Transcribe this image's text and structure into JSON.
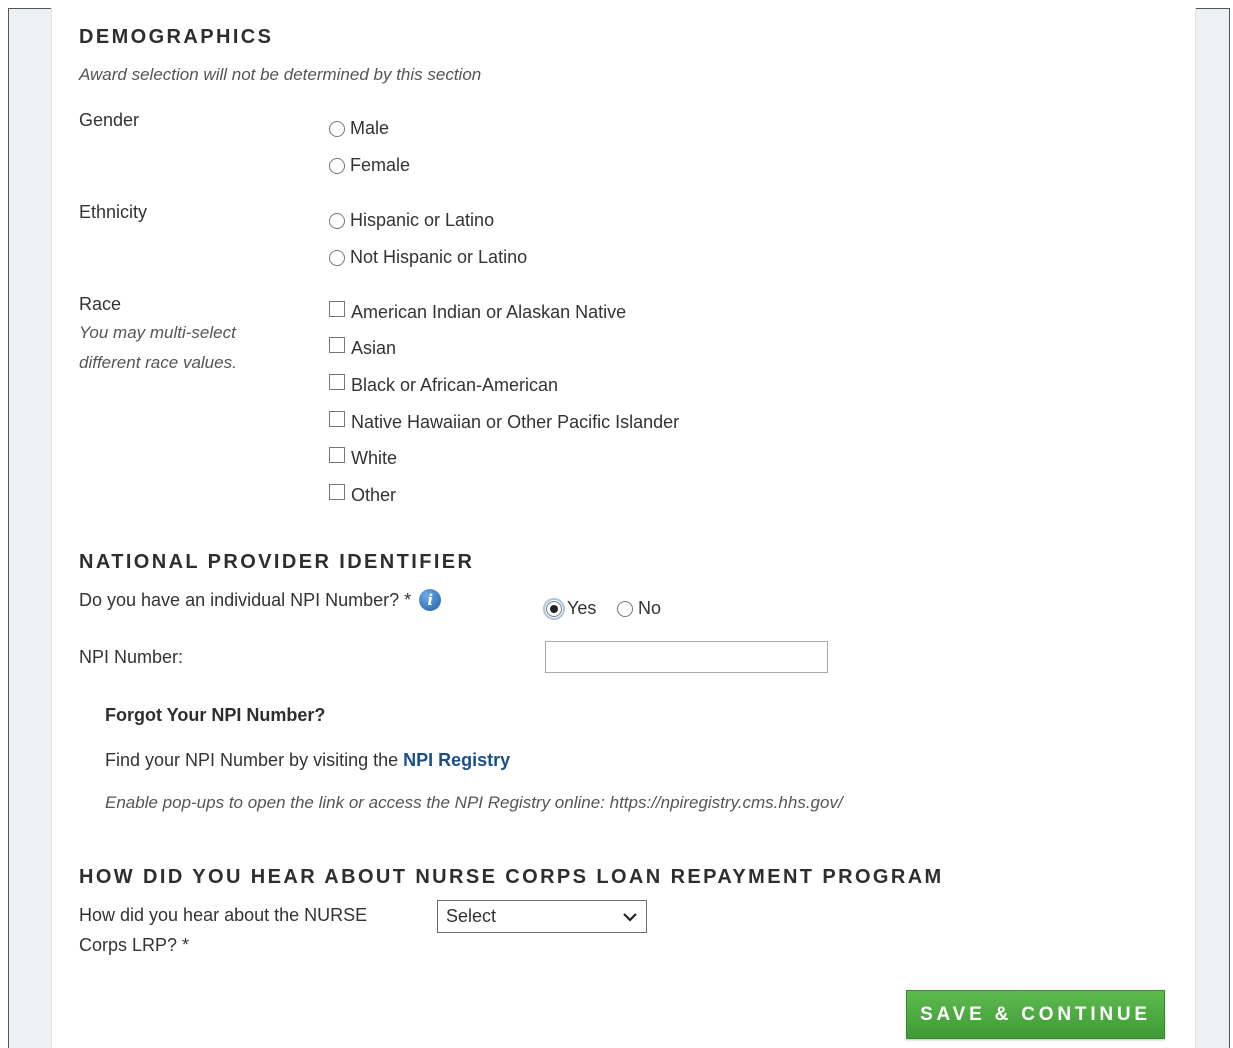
{
  "demographics": {
    "heading": "DEMOGRAPHICS",
    "note": "Award selection will not be determined by this section",
    "gender": {
      "label": "Gender",
      "options": [
        "Male",
        "Female"
      ]
    },
    "ethnicity": {
      "label": "Ethnicity",
      "options": [
        "Hispanic or Latino",
        "Not Hispanic or Latino"
      ]
    },
    "race": {
      "label": "Race",
      "hint_line1": "You may multi-select",
      "hint_line2": "different race values.",
      "options": [
        "American Indian or Alaskan Native",
        "Asian",
        "Black or African-American",
        "Native Hawaiian or Other Pacific Islander",
        "White",
        "Other"
      ]
    }
  },
  "npi": {
    "heading": "NATIONAL PROVIDER IDENTIFIER",
    "question": "Do you have an individual NPI Number? *",
    "yes_label": "Yes",
    "no_label": "No",
    "selected": "Yes",
    "number_label": "NPI Number:",
    "number_value": "",
    "forgot_heading": "Forgot Your NPI Number?",
    "find_text": "Find your NPI Number by visiting the",
    "registry_link": "NPI Registry",
    "popup_note": "Enable pop-ups to open the link or access the NPI Registry online: https://npiregistry.cms.hhs.gov/"
  },
  "hear": {
    "heading": "HOW DID YOU HEAR ABOUT NURSE CORPS LOAN REPAYMENT PROGRAM",
    "label_line1": "How did you hear about the NURSE",
    "label_line2": "Corps LRP? *",
    "select_value": "Select"
  },
  "actions": {
    "save_label": "SAVE & CONTINUE"
  },
  "colors": {
    "button": "#4aa93e",
    "link": "#1a4f8b",
    "info_icon": "#2a6fbd"
  }
}
